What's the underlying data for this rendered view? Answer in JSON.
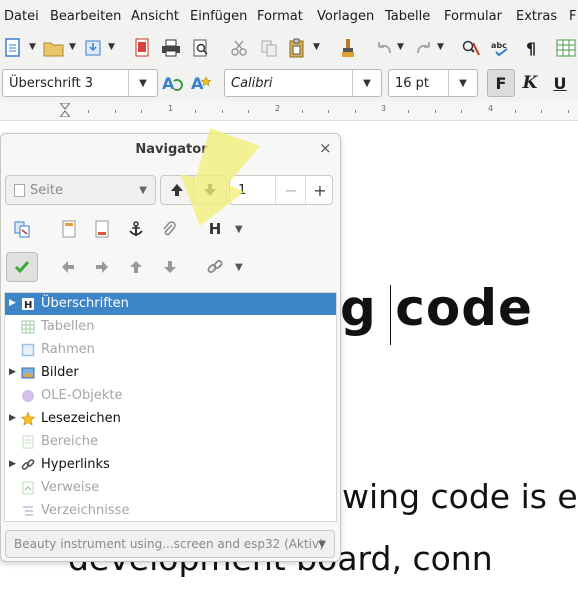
{
  "menu": {
    "items": [
      "Datei",
      "Bearbeiten",
      "Ansicht",
      "Einfügen",
      "Format",
      "Vorlagen",
      "Tabelle",
      "Formular",
      "Extras",
      "F"
    ]
  },
  "format_bar": {
    "paragraph_style": "Überschrift 3",
    "font_name": "Calibri",
    "font_size": "16 pt",
    "bold_label": "F",
    "italic_label": "K",
    "underline_label": "U"
  },
  "ruler": {
    "numbers": [
      "1",
      "2",
      "3",
      "4"
    ]
  },
  "document": {
    "heading_visible": "g code",
    "line1_visible": "wing code is e",
    "line2_visible": "development board, conn"
  },
  "navigator": {
    "title": "Navigator",
    "close_glyph": "×",
    "nav_type_value": "Seite",
    "page_number": "1",
    "minus_glyph": "−",
    "plus_glyph": "+",
    "heading_button_label": "H",
    "categories": [
      {
        "label": "Überschriften",
        "icon": "headings-icon",
        "expandable": true,
        "selected": true,
        "enabled": true
      },
      {
        "label": "Tabellen",
        "icon": "table-icon",
        "expandable": false,
        "selected": false,
        "enabled": false
      },
      {
        "label": "Rahmen",
        "icon": "frame-icon",
        "expandable": false,
        "selected": false,
        "enabled": false
      },
      {
        "label": "Bilder",
        "icon": "image-icon",
        "expandable": true,
        "selected": false,
        "enabled": true
      },
      {
        "label": "OLE-Objekte",
        "icon": "ole-object-icon",
        "expandable": false,
        "selected": false,
        "enabled": false
      },
      {
        "label": "Lesezeichen",
        "icon": "bookmark-star-icon",
        "expandable": true,
        "selected": false,
        "enabled": true
      },
      {
        "label": "Bereiche",
        "icon": "section-icon",
        "expandable": false,
        "selected": false,
        "enabled": false
      },
      {
        "label": "Hyperlinks",
        "icon": "hyperlink-icon",
        "expandable": true,
        "selected": false,
        "enabled": true
      },
      {
        "label": "Verweise",
        "icon": "reference-icon",
        "expandable": false,
        "selected": false,
        "enabled": false
      },
      {
        "label": "Verzeichnisse",
        "icon": "index-icon",
        "expandable": false,
        "selected": false,
        "enabled": false
      }
    ],
    "document_select": "Beauty instrument using...screen and esp32 (Aktiv)"
  },
  "colors": {
    "selection": "#3d85c6",
    "highlighter": "#f3f07a",
    "check_green": "#3da63d"
  }
}
